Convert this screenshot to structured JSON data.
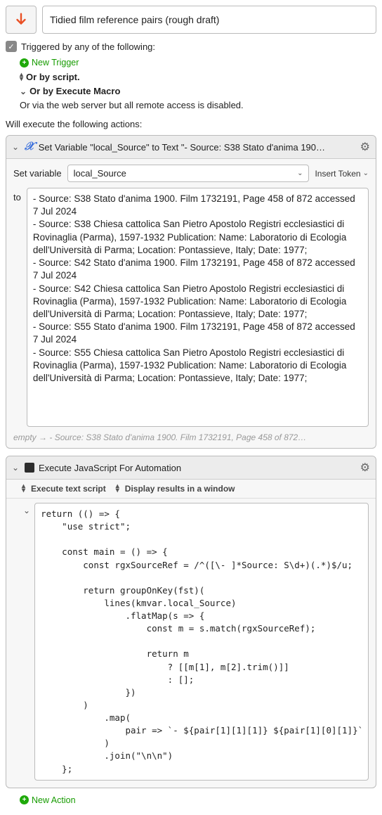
{
  "macro_title": "Tidied film reference pairs (rough draft)",
  "trigger_label": "Triggered by any of the following:",
  "new_trigger": "New Trigger",
  "or_by_script": "Or by script.",
  "or_by_execute_macro": "Or by Execute Macro",
  "or_via_web": "Or via the web server but all remote access is disabled.",
  "actions_head": "Will execute the following actions:",
  "action1": {
    "title": "Set Variable \"local_Source\" to Text \"- Source: S38 Stato d'anima 190…",
    "set_variable_label": "Set variable",
    "variable_name": "local_Source",
    "insert_token": "Insert Token",
    "to_label": "to",
    "to_text": "- Source: S38 Stato d'anima 1900. Film 1732191, Page 458 of 872 accessed 7 Jul 2024\n- Source: S38 Chiesa cattolica San Pietro Apostolo Registri ecclesiastici di Rovinaglia (Parma), 1597-1932 Publication: Name: Laboratorio di Ecologia dell'Università di Parma; Location: Pontassieve, Italy; Date: 1977;\n- Source: S42 Stato d'anima 1900. Film 1732191, Page 458 of 872 accessed 7 Jul 2024\n- Source: S42 Chiesa cattolica San Pietro Apostolo Registri ecclesiastici di Rovinaglia (Parma), 1597-1932 Publication: Name: Laboratorio di Ecologia dell'Università di Parma; Location: Pontassieve, Italy; Date: 1977;\n- Source: S55 Stato d'anima 1900. Film 1732191, Page 458 of 872 accessed 7 Jul 2024\n- Source: S55 Chiesa cattolica San Pietro Apostolo Registri ecclesiastici di Rovinaglia (Parma), 1597-1932 Publication: Name: Laboratorio di Ecologia dell'Università di Parma; Location: Pontassieve, Italy; Date: 1977;",
    "empty_label": "empty",
    "empty_preview": "- Source: S38 Stato d'anima 1900. Film 1732191, Page 458 of 872…"
  },
  "action2": {
    "title": "Execute JavaScript For Automation",
    "execute_text_script": "Execute text script",
    "display_results": "Display results in a window",
    "code": "return (() => {\n    \"use strict\";\n\n    const main = () => {\n        const rgxSourceRef = /^([\\- ]*Source: S\\d+)(.*)$/u;\n\n        return groupOnKey(fst)(\n            lines(kmvar.local_Source)\n                .flatMap(s => {\n                    const m = s.match(rgxSourceRef);\n\n                    return m\n                        ? [[m[1], m[2].trim()]]\n                        : [];\n                })\n        )\n            .map(\n                pair => `- ${pair[1][1][1]} ${pair[1][0][1]}`\n            )\n            .join(\"\\n\\n\")\n    };"
  },
  "new_action": "New Action"
}
